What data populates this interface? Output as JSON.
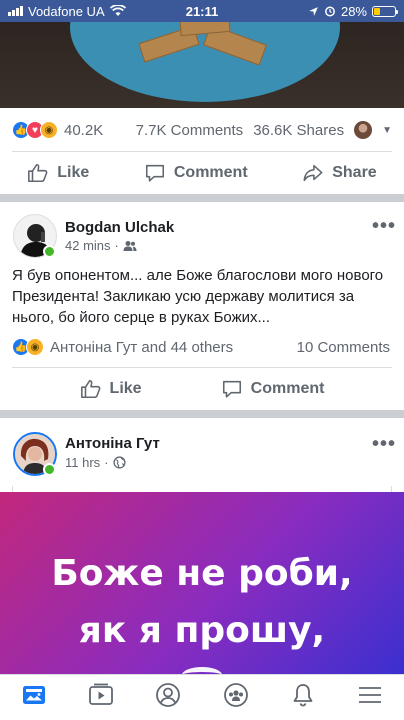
{
  "status_bar": {
    "carrier": "Vodafone UA",
    "time": "21:11",
    "battery": "28%",
    "battery_level": 0.28
  },
  "post1": {
    "reaction_count": "40.2K",
    "comments": "7.7K Comments",
    "shares": "36.6K Shares",
    "actions": {
      "like": "Like",
      "comment": "Comment",
      "share": "Share"
    }
  },
  "post2": {
    "author": "Bogdan  Ulchak",
    "time": "42 mins",
    "text": "Я був опонентом... але Боже благослови мого нового Президента! Закликаю усю державу молитися за нього, бо його серце в руках Божих...",
    "reactions_text": "Антоніна Гут and 44 others",
    "comments": "10 Comments",
    "actions": {
      "like": "Like",
      "comment": "Comment"
    }
  },
  "post3": {
    "author": "Антоніна Гут",
    "time": "11 hrs",
    "image_text": [
      "Боже не роби,",
      "як я прошу,"
    ]
  },
  "icons": {
    "tabs": [
      "news-feed-icon",
      "watch-icon",
      "profile-icon",
      "groups-icon",
      "notifications-icon",
      "menu-icon"
    ]
  },
  "colors": {
    "brand": "#3b5998",
    "accent": "#1877f2",
    "online": "#42b72a"
  }
}
